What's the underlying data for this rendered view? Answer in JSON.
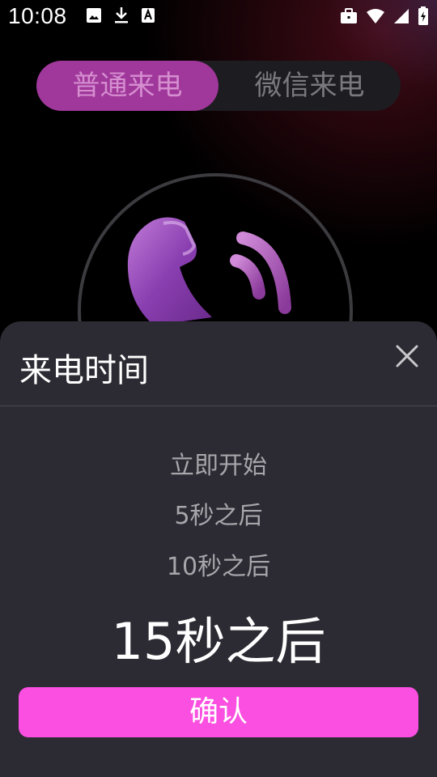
{
  "status_bar": {
    "time": "10:08",
    "left_icons": [
      "image-icon",
      "download-icon",
      "font-icon"
    ],
    "right_icons": [
      "briefcase-icon",
      "wifi-icon",
      "signal-icon",
      "battery-icon"
    ]
  },
  "tabs": [
    {
      "label": "普通来电",
      "selected": true
    },
    {
      "label": "微信来电",
      "selected": false
    }
  ],
  "sheet": {
    "title": "来电时间",
    "options": [
      "立即开始",
      "5秒之后",
      "10秒之后"
    ],
    "selected_option": "15秒之后",
    "confirm_label": "确认"
  },
  "colors": {
    "accent": "#fa4fe0",
    "tab_selected": "#a0379a",
    "sheet_bg": "#2c2a32"
  }
}
